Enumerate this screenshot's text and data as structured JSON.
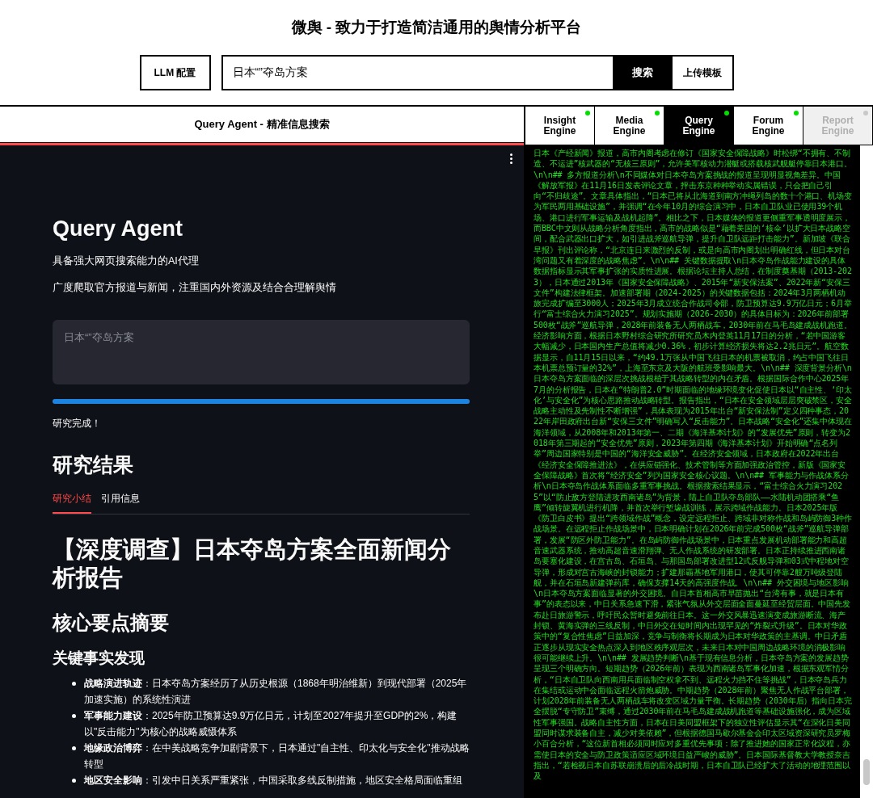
{
  "header": {
    "title": "微舆 - 致力于打造简洁通用的舆情分析平台",
    "llm_button": "LLM 配置",
    "search_field": {
      "value": "日本“”夺岛方案"
    },
    "search_button": "搜索",
    "upload_button": "上传模板"
  },
  "left_panel": {
    "title": "Query Agent - 精准信息搜索",
    "app": {
      "heading": "Query Agent",
      "subtitle": "具备强大网页搜索能力的AI代理",
      "description": "广度爬取官方报道与新闻，注重国内外资源及结合合理解舆情",
      "query_field": {
        "placeholder": "日本“”夺岛方案"
      },
      "progress": {
        "level": 1
      },
      "status": "研究完成！",
      "results_heading": "研究结果",
      "tabs": [
        {
          "label": "研究小结",
          "selected": true
        },
        {
          "label": "引用信息",
          "selected": false
        }
      ],
      "report": {
        "title": "【深度调查】日本夺岛方案全面新闻分析报告",
        "section": "核心要点摘要",
        "subsection": "关键事实发现",
        "bullets": [
          {
            "label": "战略演进轨迹",
            "text": "：日本夺岛方案经历了从历史根源（1868年明治维新）到现代部署（2025年加速实施）的系统性演进"
          },
          {
            "label": "军事能力建设",
            "text": "：2025年防卫预算达9.9万亿日元，计划至2027年提升至GDP的2%，构建以\"反击能力\"为核心的战略威慑体系"
          },
          {
            "label": "地缘政治博弈",
            "text": "：在中美战略竞争加剧背景下，日本通过\"自主性、印太化与安全化\"推动战略转型"
          },
          {
            "label": "地区安全影响",
            "text": "：引发中日关系严重紧张，中国采取多线反制措施，地区安全格局面临重组"
          }
        ]
      }
    }
  },
  "engine_tabs": [
    {
      "label": "Insight Engine",
      "selected": false,
      "disabled": false,
      "color": "#00e000"
    },
    {
      "label": "Media Engine",
      "selected": false,
      "disabled": false,
      "color": "#00e000"
    },
    {
      "label": "Query Engine",
      "selected": true,
      "disabled": false,
      "color": "#00e000"
    },
    {
      "label": "Forum Engine",
      "selected": false,
      "disabled": false,
      "color": "#00e000"
    },
    {
      "label": "Report Engine",
      "selected": false,
      "disabled": true,
      "color": "#c8c8c8"
    }
  ],
  "log": "日本《产经新闻》报道，高市内阁考虑在修订《国家安全保障战略》时松绑“不拥有、不制造、不运进”核武器的“无核三原则”，允许美军核动力潜艇或搭载核武舰艇停靠日本港口。\\n\\n## 多方报道分析\\n不同媒体对日本夺岛方案挑战的报道呈现明显视角差异。中国《解放军报》在11月16日发表评论文章，抨击东京种种举动实属错误，只会把自己引向“不归歧途”。文章具体指出，“日本已将从北海道到南方冲绳列岛的数十个港口、机场变为军民两用基础设施”，并强调“在今年10月的综合演习中，日本自卫队业已使用39个机场、港口进行军事运输及战机起降”。相比之下，日本媒体的报道更侧重军事透明度展示，而BBC中文则从战略分析角度指出，高市的战略似是“藉着美国的‘核伞’以扩大日本战略空间，配合武器出口扩大，如引进战斧巡航导弹，提升自卫队远距打击能力”。新加坡《联合早报》刊出评论称，“北京连日来激烈的反制，或是向高市内阁划出明确红线，但日本对台湾问题又有着深度的战略焦虑”。\\n\\n## 关键数据提取\\n日本夺岛作战能力建设的具体数据指标显示其军事扩张的实质性进展。根据论坛主持人总结，在制度奠基期（2013-2023），日本通过2013年《国家安全保障战略》、2015年“新安保法案”、2022年新“安保三文件”构建法律框架。加速部署期（2024-2025）的关键数据包括：2024年3月两栖机动旅完成扩编至3000人；2025年3月成立统合作战司令部，防卫预算达9.9万亿日元；6月举行“富士综合火力演习2025”。规划实施期（2026-2030）的具体目标为：2026年前部署500枚“战斧”巡航导弹，2028年前装备无人两栖战车，2030年前在马毛岛建成战机跑道。经济影响方面，根据日本野村综合研究所研究员木内登英11月17日的分析，“若中国游客大幅减少，日本国内生产总值将减少0.36%，初步计算经济损失将达2.2兆日元”。航空数据显示，自11月15日以来，“约49.1万张从中国飞往日本的机票被取消，约占中国飞往日本机票总预订量的32%”，上海至东京及大阪的航班受影响最大。\\n\\n## 深度背景分析\\n日本夺岛方案面临的深层次挑战根植于其战略转型的内在矛盾。根据国际合作中心2025年7月的分析报告，日本在“特朗普2.0”时期面临的地缘环境变化促使日本以“自主性、‘印太化’与安全化”为核心思路推动战略转型。报告指出，“日本在安全领域层层突破禁区，安全战略主动性及先制性不断增强”，具体表现为2015年出台“新安保法制”定义四种事态，2022年岸田政府出台新“安保三文件”明确写入“反击能力”。日本战略“安全化”还集中体现在海洋领域，从2008年和2013年第一、二期《海洋基本计划》的“发展优先”原则，转变为2018年第三期起的“安全优先”原则，2023年第四期《海洋基本计划》开始明确“点名列举”周边国家特别是中国的“海洋安全威胁”。在经济安全领域，日本政府在2022年出台《经济安全保障推进法》，在供应链强化、技术管制等方面加强政治管控，新版《国家安全保障战略》首次将“经济安全”列为国家安全核心议题。\\n\\n## 军事能力与作战体系分析\\n日本夺岛作战体系面临多重军事挑战。根据搜索结果显示，“富士综合火力演习2025”以“防止敌方登陆进攻西南诸岛”为背景，陆上自卫队夺岛部队——水陆机动团搭乘“鱼鹰”倾转旋翼机进行机降，并首次举行堑壕战训练，展示跨域作战能力。日本2025年版《防卫白皮书》提出“跨领域作战”概念，设定远程拒止、跨域非对称作战和岛屿防御3种作战场景。在远程拒止作战场景中，日本明确计划在2026年前完成500枚“战斧”巡航导弹部署，发展“防区外防卫能力”。在岛屿防御作战场景中，日本重点发展机动部署能力和高超音速武器系统，推动高超音速滑翔弹、无人作战系统的研发部署。日本正持续推进西南诸岛要塞化建设，在宫古岛、石垣岛、与那国岛部署改进型12式反舰导弹和03式中程地对空导弹，形成对宫古海峡的封锁能力；扩建那霸基地军用港口，使其可停靠2艘万吨级登陆舰，并在石垣岛新建弹药库，确保支撑14天的高强度作战。\\n\\n## 外交困境与地区影响\\n日本夺岛方案面临显著的外交困境。自日本首相高市早苗抛出“台湾有事，就是日本有事”的表态以来，中日关系急速下滑，紧张气氛从外交层面全面蔓延至经贸层面。中国先发布赴日旅游警示，呼吁民众暂时避免前往日本。这一外交风暴迅速演变成旅游断流、海产封锁、黄海实弹的三线反制，中日外交在短时间内出现罕见的“炸裂式升级”。日本对华政策中的“复合性焦虑”日益加深，竞争与制衡将长期成为日本对华政策的主基调。中日矛盾正逐步从现实安全热点深入到地区秩序观层次，未来日本对中国周边战略环境的消极影响很可能继续上升。\\n\\n## 发展趋势判断\\n基于现有信息分析，日本夺岛方案的发展趋势呈现三个明确方向。短期趋势（2026年前）表现为西南诸岛军事化加速，根据东观军情分析，“日本自卫队向西南用兵面临制空权拿不到、远程火力挡不住等挑战”，日本夺岛兵力在集结或运动中会面临远程火箭炮威胁。中期趋势（2028年前）聚焦无人作战平台部署，计划2028年前装备无人两栖战车将改变区域力量平衡。长期趋势（2030年后）指向日本完全摆脱“专守防卫”束缚，通过2030年前在马毛岛建成战机跑道等基础设施强化，成为区域性军事强国。战略自主性方面，日本在日美同盟框架下的独立性评估显示其“在深化日美同盟同时谋求装备自主，减少对美依赖”，但根据德国马歇尔基金会印太区域资深研究员罗梅小百合分析，“这位新首相必须同时应对多重优先事项：除了推进她的国家正常化议程，亦需使日本的安全与防卫政策适应区域环境日益严峻的威胁”。日本国际基督教大学教授奈吉指出，“若检视日本自苏联崩溃后的后冷战时期，日本自卫队已经扩大了活动的地理范围以及"
}
